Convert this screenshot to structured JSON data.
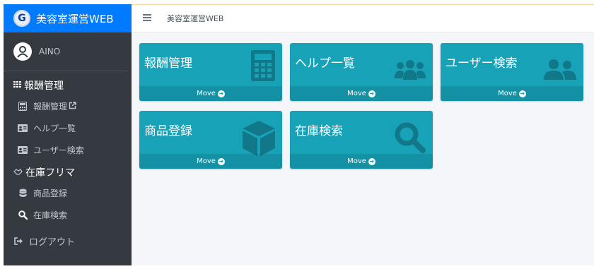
{
  "brand": {
    "logo_letter": "G",
    "title": "美容室運営WEB"
  },
  "user": {
    "name": "AINO"
  },
  "sidebar": {
    "groups": [
      {
        "header": "報酬管理",
        "icon": "grid-icon",
        "items": [
          {
            "label": "報酬管理",
            "icon": "calculator-icon",
            "external": true
          },
          {
            "label": "ヘルプ一覧",
            "icon": "id-card-icon"
          },
          {
            "label": "ユーザー検索",
            "icon": "id-card-icon"
          }
        ]
      },
      {
        "header": "在庫フリマ",
        "icon": "handshake-icon",
        "items": [
          {
            "label": "商品登録",
            "icon": "database-icon"
          },
          {
            "label": "在庫検索",
            "icon": "search-icon"
          }
        ]
      }
    ],
    "logout": "ログアウト"
  },
  "topbar": {
    "title": "美容室運営WEB"
  },
  "tiles": [
    {
      "title": "報酬管理",
      "footer": "Move",
      "icon": "calculator-icon"
    },
    {
      "title": "ヘルプ一覧",
      "footer": "Move",
      "icon": "users-icon"
    },
    {
      "title": "ユーザー検索",
      "footer": "Move",
      "icon": "user-friends-icon"
    },
    {
      "title": "商品登録",
      "footer": "Move",
      "icon": "box-icon"
    },
    {
      "title": "在庫検索",
      "footer": "Move",
      "icon": "search-icon"
    }
  ],
  "colors": {
    "sidebar": "#343a40",
    "brand": "#007bff",
    "tile": "#17a2b8",
    "content_bg": "#f4f6f9"
  }
}
